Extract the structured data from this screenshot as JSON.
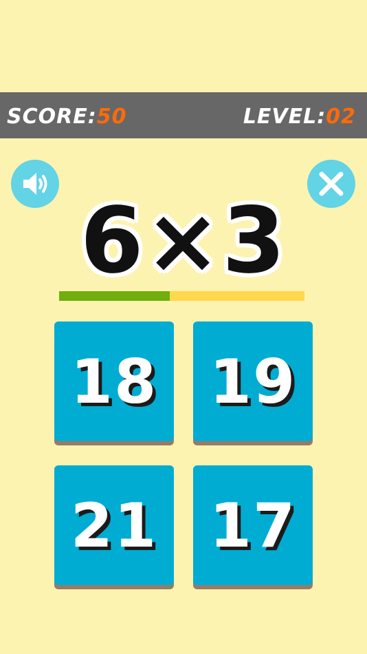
{
  "hud": {
    "score_label": "SCORE:",
    "score_value": "50",
    "level_label": "LEVEL:",
    "level_value": "02"
  },
  "controls": {
    "sound_icon": "speaker-icon",
    "close_icon": "close-icon"
  },
  "problem": {
    "text": "6×3"
  },
  "timer": {
    "remaining_fraction": 0.45,
    "fill_color": "#6fae0d",
    "track_color": "#ffd84d"
  },
  "answers": [
    "18",
    "19",
    "21",
    "17"
  ],
  "colors": {
    "background": "#fdf3b0",
    "bar": "#676767",
    "accent": "#ff6a0a",
    "button": "#00acd2",
    "round_button": "#63d3e6"
  }
}
